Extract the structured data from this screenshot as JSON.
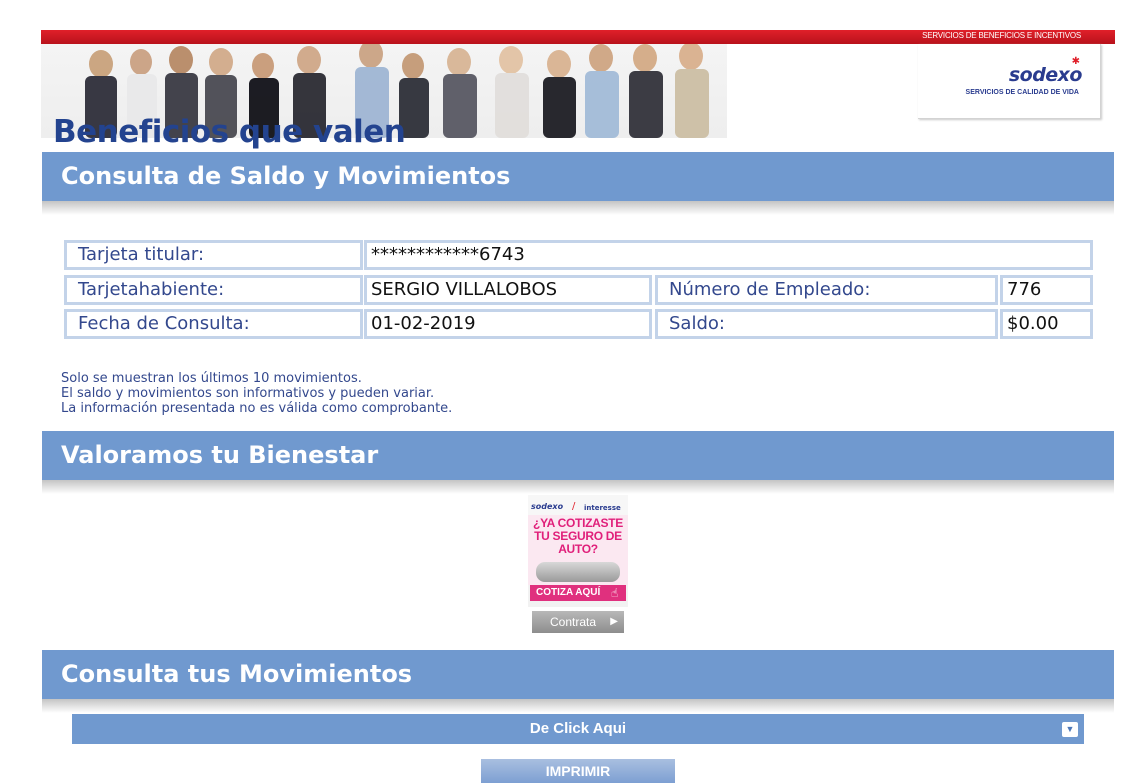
{
  "header": {
    "top_bar_text": "SERVICIOS DE BENEFICIOS E INCENTIVOS",
    "tagline": "Beneficios que valen",
    "logo_text": "sodexo",
    "logo_subtitle": "SERVICIOS DE CALIDAD DE VIDA"
  },
  "sections": {
    "balance_title": "Consulta de Saldo y Movimientos",
    "wellness_title": "Valoramos tu Bienestar",
    "movements_title": "Consulta tus Movimientos"
  },
  "info": {
    "card_label": "Tarjeta titular:",
    "card_value": "************6743",
    "holder_label": "Tarjetahabiente:",
    "holder_value": "SERGIO VILLALOBOS",
    "employee_label": "Número de Empleado:",
    "employee_value": "776",
    "date_label": "Fecha de Consulta:",
    "date_value": "01-02-2019",
    "balance_label": "Saldo:",
    "balance_value": "$0.00"
  },
  "notes": [
    "Solo se muestran los últimos 10 movimientos.",
    "El saldo y movimientos son informativos y pueden variar.",
    "La información presentada no es válida como comprobante."
  ],
  "ad": {
    "brand_left": "sodexo",
    "brand_right": "interesse",
    "headline_line1": "¿YA COTIZASTE",
    "headline_line2": "TU SEGURO DE",
    "headline_line3": "AUTO?",
    "cta": "COTIZA AQUÍ",
    "button_label": "Contrata"
  },
  "dropdown": {
    "selected": "De Click Aqui"
  },
  "print_button": "IMPRIMIR",
  "colors": {
    "section_blue": "#7099cf",
    "cell_border": "#c3d3e9",
    "label_text": "#33488d",
    "brand_red": "#e0202a",
    "ad_pink": "#e01f7a"
  },
  "icons": [
    "dropdown-arrow-icon",
    "play-arrow-icon",
    "hand-pointer-icon"
  ]
}
